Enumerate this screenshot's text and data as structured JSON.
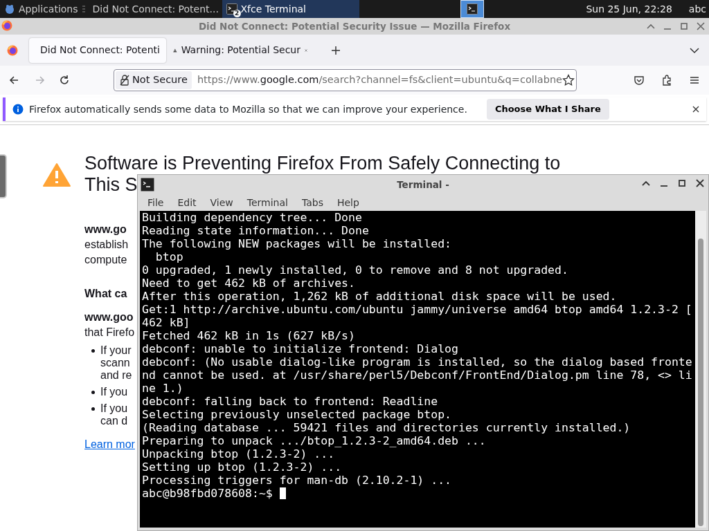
{
  "taskbar": {
    "apps_menu": "Applications",
    "tasks": [
      {
        "label": "Did Not Connect: Potent...",
        "kind": "firefox",
        "selected": false
      },
      {
        "label": "Xfce Terminal",
        "kind": "terminal",
        "selected": true,
        "badge": "2"
      }
    ],
    "clock": "Sun 25 Jun, 22:28",
    "user": "abc"
  },
  "firefox": {
    "title": "Did Not Connect: Potential Security Issue — Mozilla Firefox",
    "tabs": [
      {
        "label": "Did Not Connect: Potenti",
        "selected": true
      },
      {
        "label": "Warning: Potential Secur",
        "selected": false
      }
    ],
    "nav_buttons": [
      {
        "kind": "back",
        "disabled": false
      },
      {
        "kind": "forward",
        "disabled": true
      },
      {
        "kind": "reload",
        "disabled": false
      }
    ],
    "address": {
      "security": "Not Secure",
      "prefix": "https://www.",
      "host": "google.com",
      "path": "/search?channel=fs&client=ubuntu&q=collabne"
    },
    "notification": {
      "text": "Firefox automatically sends some data to Mozilla so that we can improve your experience.",
      "button": "Choose What I Share"
    },
    "page": {
      "heading_lines": [
        "Software is Preventing Firefox From Safely Connecting to",
        "This S"
      ],
      "blocks": [
        {
          "kind": "bold",
          "lines": [
            "www.go"
          ]
        },
        {
          "kind": "text",
          "lines": [
            "establish",
            "compute"
          ]
        },
        {
          "kind": "heading",
          "lines": [
            "What ca"
          ]
        },
        {
          "kind": "bold",
          "lines": [
            "www.goo"
          ]
        },
        {
          "kind": "text",
          "lines": [
            "that Firefo"
          ]
        },
        {
          "kind": "bullet",
          "lines": [
            "If your",
            "scann",
            "and re"
          ]
        },
        {
          "kind": "bullet",
          "lines": [
            "If you"
          ]
        },
        {
          "kind": "bullet",
          "lines": [
            "If you",
            "can d"
          ]
        },
        {
          "kind": "link",
          "lines": [
            "Learn mor"
          ]
        }
      ]
    }
  },
  "terminal": {
    "title": "Terminal -",
    "menu": [
      "File",
      "Edit",
      "View",
      "Terminal",
      "Tabs",
      "Help"
    ],
    "lines": [
      "Building dependency tree... Done",
      "Reading state information... Done",
      "The following NEW packages will be installed:",
      "  btop",
      "0 upgraded, 1 newly installed, 0 to remove and 8 not upgraded.",
      "Need to get 462 kB of archives.",
      "After this operation, 1,262 kB of additional disk space will be used.",
      "Get:1 http://archive.ubuntu.com/ubuntu jammy/universe amd64 btop amd64 1.2.3-2 [",
      "462 kB]",
      "Fetched 462 kB in 1s (627 kB/s)",
      "debconf: unable to initialize frontend: Dialog",
      "debconf: (No usable dialog-like program is installed, so the dialog based fronte",
      "nd cannot be used. at /usr/share/perl5/Debconf/FrontEnd/Dialog.pm line 78, <> li",
      "ne 1.)",
      "debconf: falling back to frontend: Readline",
      "Selecting previously unselected package btop.",
      "(Reading database ... 59421 files and directories currently installed.)",
      "Preparing to unpack .../btop_1.2.3-2_amd64.deb ...",
      "Unpacking btop (1.2.3-2) ...",
      "Setting up btop (1.2.3-2) ...",
      "Processing triggers for man-db (2.10.2-1) ..."
    ],
    "prompt": "abc@b98fbd078608:~$"
  }
}
